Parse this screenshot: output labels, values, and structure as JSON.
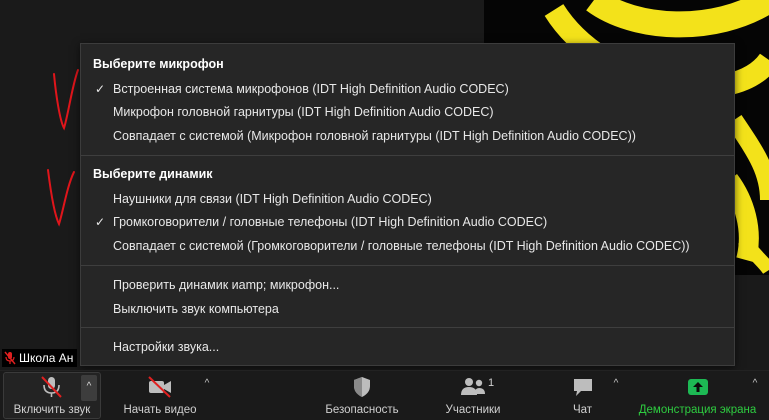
{
  "video": {
    "participant_name": "Школа Ан"
  },
  "audio_menu": {
    "microphone_heading": "Выберите микрофон",
    "microphones": [
      {
        "label": "Встроенная система микрофонов (IDT High Definition Audio CODEC)",
        "selected": true
      },
      {
        "label": "Микрофон головной гарнитуры (IDT High Definition Audio CODEC)",
        "selected": false
      },
      {
        "label": "Совпадает с системой (Микрофон головной гарнитуры (IDT High Definition Audio CODEC))",
        "selected": false
      }
    ],
    "speaker_heading": "Выберите динамик",
    "speakers": [
      {
        "label": "Наушники для связи (IDT High Definition Audio CODEC)",
        "selected": false
      },
      {
        "label": "Громкоговорители / головные телефоны (IDT High Definition Audio CODEC)",
        "selected": true
      },
      {
        "label": "Совпадает с системой (Громкоговорители / головные телефоны (IDT High Definition Audio CODEC))",
        "selected": false
      }
    ],
    "actions": [
      {
        "label": "Проверить динамик иamp; микрофон..."
      },
      {
        "label": "Выключить звук компьютера"
      }
    ],
    "settings_label": "Настройки звука...",
    "check_glyph": "✓"
  },
  "toolbar": {
    "unmute_label": "Включить звук",
    "start_video_label": "Начать видео",
    "security_label": "Безопасность",
    "participants_label": "Участники",
    "participants_count": "1",
    "chat_label": "Чат",
    "share_label": "Демонстрация экрана",
    "caret_glyph": "^"
  },
  "colors": {
    "share_green": "#2ecc40",
    "share_icon_bg": "#1db954",
    "mute_red": "#e02020",
    "annotation_red": "#e0151b",
    "tile_yellow": "#f3e21a"
  }
}
